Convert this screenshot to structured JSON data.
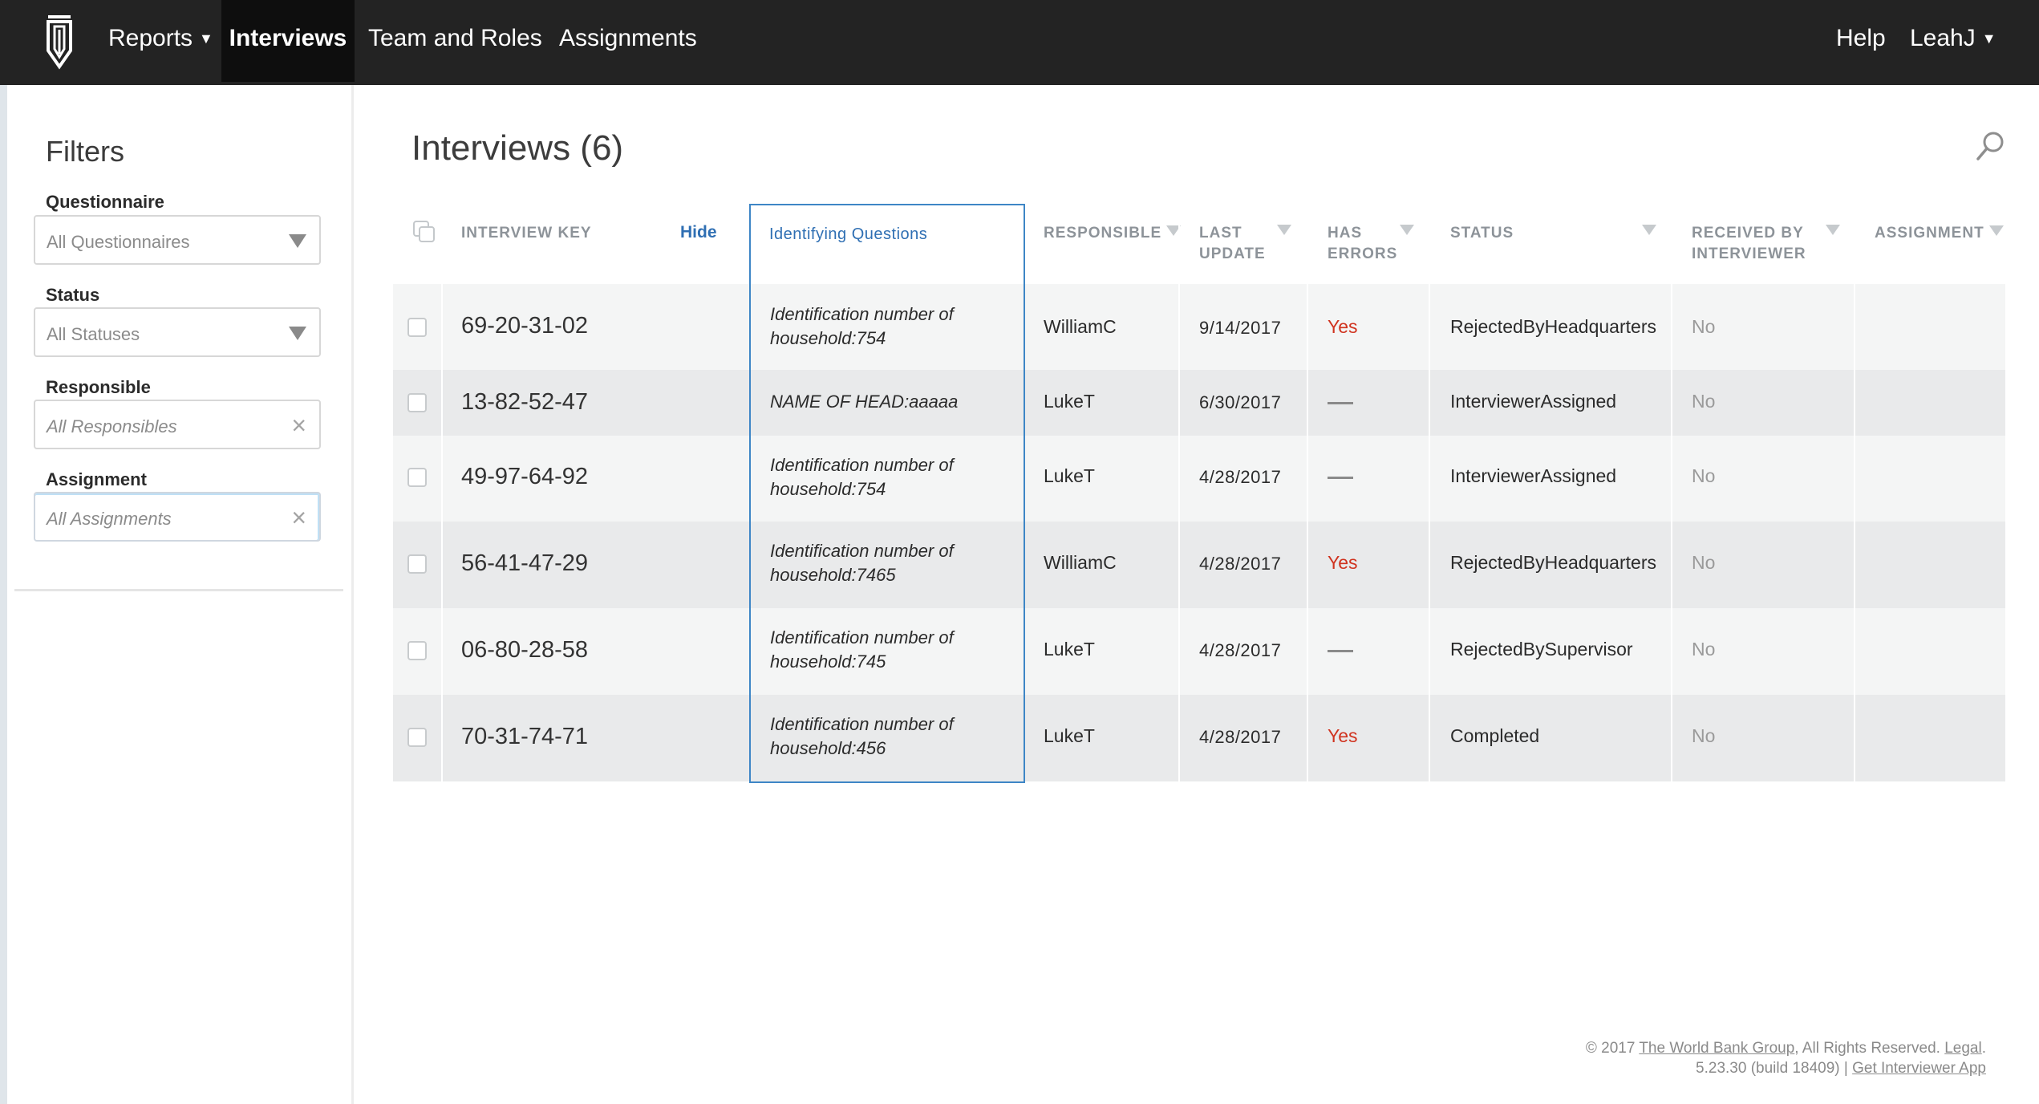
{
  "nav": {
    "items": [
      {
        "label": "Reports",
        "has_caret": true
      },
      {
        "label": "Interviews",
        "active": true
      },
      {
        "label": "Team and Roles"
      },
      {
        "label": "Assignments"
      }
    ],
    "help": "Help",
    "user": "LeahJ"
  },
  "filters": {
    "title": "Filters",
    "questionnaire": {
      "label": "Questionnaire",
      "placeholder": "All Questionnaires"
    },
    "status": {
      "label": "Status",
      "placeholder": "All Statuses"
    },
    "responsible": {
      "label": "Responsible",
      "placeholder": "All Responsibles"
    },
    "assignment": {
      "label": "Assignment",
      "placeholder": "All Assignments"
    }
  },
  "main": {
    "title": "Interviews (6)",
    "columns": {
      "interview_key": "Interview Key",
      "hide": "Hide",
      "identifying_questions": "Identifying Questions",
      "responsible": "Responsible",
      "last_update_1": "Last",
      "last_update_2": "Update",
      "has_errors_1": "Has",
      "has_errors_2": "Errors",
      "status": "Status",
      "received_1": "Received by",
      "received_2": "Interviewer",
      "assignment": "Assignment"
    },
    "rows": [
      {
        "key": "69-20-31-02",
        "iq1": "Identification number of",
        "iq2": "household:754",
        "responsible": "WilliamC",
        "date": "9/14/2017",
        "errors": "Yes",
        "status": "RejectedByHeadquarters",
        "received": "No"
      },
      {
        "key": "13-82-52-47",
        "iq1": "NAME OF HEAD:aaaaa",
        "iq2": "",
        "responsible": "LukeT",
        "date": "6/30/2017",
        "errors": "",
        "status": "InterviewerAssigned",
        "received": "No"
      },
      {
        "key": "49-97-64-92",
        "iq1": "Identification number of",
        "iq2": "household:754",
        "responsible": "LukeT",
        "date": "4/28/2017",
        "errors": "",
        "status": "InterviewerAssigned",
        "received": "No"
      },
      {
        "key": "56-41-47-29",
        "iq1": "Identification number of",
        "iq2": "household:7465",
        "responsible": "WilliamC",
        "date": "4/28/2017",
        "errors": "Yes",
        "status": "RejectedByHeadquarters",
        "received": "No"
      },
      {
        "key": "06-80-28-58",
        "iq1": "Identification number of",
        "iq2": "household:745",
        "responsible": "LukeT",
        "date": "4/28/2017",
        "errors": "",
        "status": "RejectedBySupervisor",
        "received": "No"
      },
      {
        "key": "70-31-74-71",
        "iq1": "Identification number of",
        "iq2": "household:456",
        "responsible": "LukeT",
        "date": "4/28/2017",
        "errors": "Yes",
        "status": "Completed",
        "received": "No"
      }
    ]
  },
  "footer": {
    "copyright": "© 2017",
    "org_link": "The World Bank Group",
    "rights": ", All Rights Reserved.",
    "legal_link": "Legal",
    "period": ".",
    "version": "5.23.30 (build 18409) |",
    "app_link": "Get Interviewer App"
  },
  "colors": {
    "nav_bg": "#232323",
    "accent": "#2f6fb3",
    "error": "#d0331f"
  }
}
